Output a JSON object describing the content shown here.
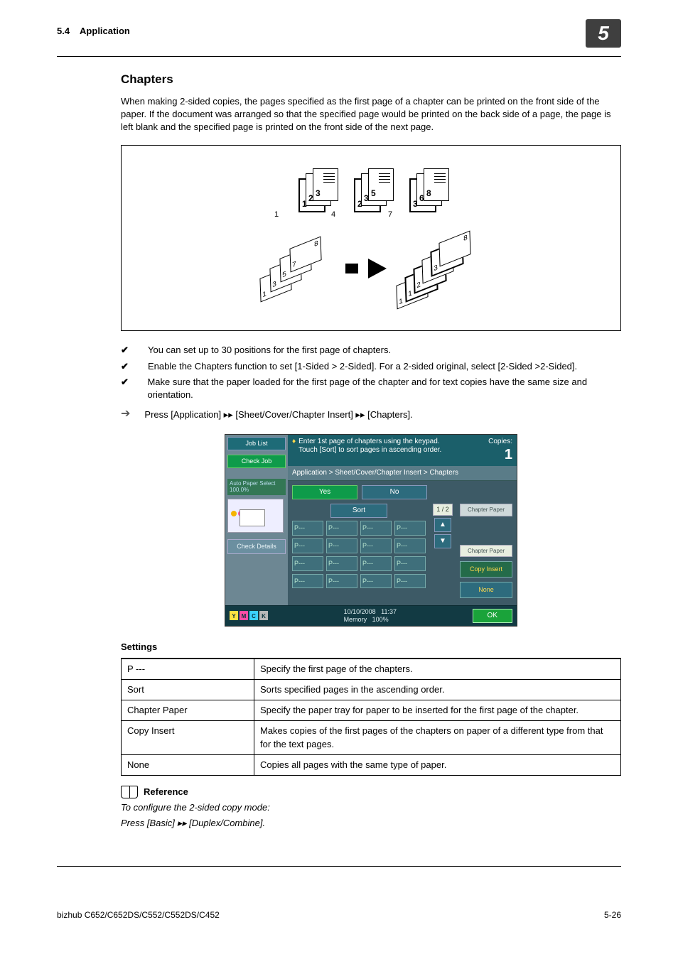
{
  "header": {
    "section_no": "5.4",
    "section_title": "Application",
    "chapter_badge": "5"
  },
  "title": "Chapters",
  "intro": "When making 2-sided copies, the pages specified as the first page of a chapter can be printed on the front side of the paper. If the document was arranged so that the specified page would be printed on the back side of a page, the page is left blank and the specified page is printed on the front side of the next page.",
  "diagram": {
    "page_labels": [
      "1",
      "2",
      "3",
      "4",
      "5",
      "6",
      "7",
      "8"
    ]
  },
  "notes": [
    "You can set up to 30 positions for the first page of chapters.",
    "Enable the Chapters function to set [1-Sided > 2-Sided]. For a 2-sided original, select [2-Sided >2-Sided].",
    "Make sure that the paper loaded for the first page of the chapter and for text copies have the same size and orientation."
  ],
  "procedure": "Press [Application] ▸▸ [Sheet/Cover/Chapter Insert] ▸▸ [Chapters].",
  "panel": {
    "joblist": "Job List",
    "checkjob": "Check Job",
    "autopaper": "Auto Paper Select  100.0%",
    "checkdetails": "Check Details",
    "hint1": "Enter 1st page of chapters using the keypad.",
    "hint2": "Touch [Sort] to sort pages in ascending order.",
    "copies_label": "Copies:",
    "copies_value": "1",
    "breadcrumb": "Application > Sheet/Cover/Chapter Insert > Chapters",
    "yes": "Yes",
    "no": "No",
    "sort": "Sort",
    "pcell": "P---",
    "page_indicator": "1 / 2",
    "chapter_paper": "Chapter Paper",
    "copy_insert": "Copy Insert",
    "none": "None",
    "date": "10/10/2008",
    "time": "11:37",
    "memory": "Memory",
    "memval": "100%",
    "ok": "OK",
    "cmyk": {
      "y": "Y",
      "m": "M",
      "c": "C",
      "k": "K"
    }
  },
  "settings": {
    "heading": "Settings",
    "rows": [
      {
        "k": "P ---",
        "v": "Specify the first page of the chapters."
      },
      {
        "k": "Sort",
        "v": "Sorts specified pages in the ascending order."
      },
      {
        "k": "Chapter Paper",
        "v": "Specify the paper tray for paper to be inserted for the first page of the chapter."
      },
      {
        "k": "Copy Insert",
        "v": "Makes copies of the first pages of the chapters on paper of a different type from that for the text pages."
      },
      {
        "k": "None",
        "v": "Copies all pages with the same type of paper."
      }
    ]
  },
  "reference": {
    "title": "Reference",
    "line1": "To configure the 2-sided copy mode:",
    "line2": "Press [Basic] ▸▸ [Duplex/Combine]."
  },
  "footer": {
    "model": "bizhub C652/C652DS/C552/C552DS/C452",
    "page": "5-26"
  }
}
